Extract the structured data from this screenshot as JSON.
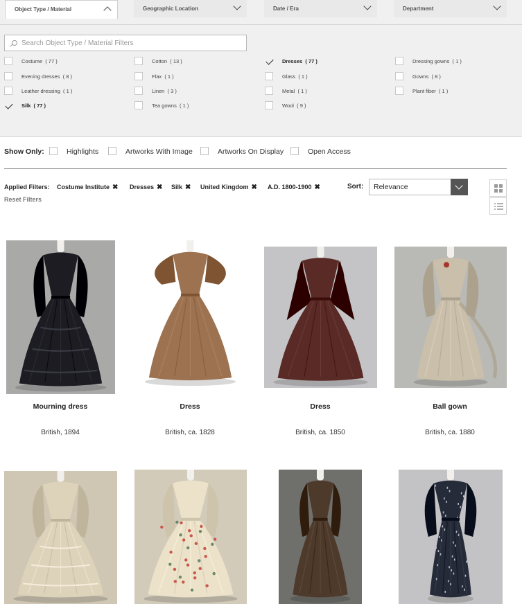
{
  "filters": {
    "dropdowns": [
      {
        "label": "Object Type / Material",
        "open": true
      },
      {
        "label": "Geographic Location",
        "open": false
      },
      {
        "label": "Date / Era",
        "open": false
      },
      {
        "label": "Department",
        "open": false
      }
    ],
    "search_placeholder": "Search Object Type / Material Filters",
    "options": [
      {
        "label": "Costume",
        "count": "( 77 )",
        "checked": false
      },
      {
        "label": "Evening dresses",
        "count": "( 8 )",
        "checked": false
      },
      {
        "label": "Leather dressing",
        "count": "( 1 )",
        "checked": false
      },
      {
        "label": "Silk",
        "count": "( 77 )",
        "checked": true
      },
      {
        "label": "Cotton",
        "count": "( 13 )",
        "checked": false
      },
      {
        "label": "Flax",
        "count": "( 1 )",
        "checked": false
      },
      {
        "label": "Linen",
        "count": "( 3 )",
        "checked": false
      },
      {
        "label": "Tea gowns",
        "count": "( 1 )",
        "checked": false
      },
      {
        "label": "Dresses",
        "count": "( 77 )",
        "checked": true
      },
      {
        "label": "Glass",
        "count": "( 1 )",
        "checked": false
      },
      {
        "label": "Metal",
        "count": "( 1 )",
        "checked": false
      },
      {
        "label": "Wool",
        "count": "( 9 )",
        "checked": false
      },
      {
        "label": "Dressing gowns",
        "count": "( 1 )",
        "checked": false
      },
      {
        "label": "Gowns",
        "count": "( 8 )",
        "checked": false
      },
      {
        "label": "Plant fiber",
        "count": "( 1 )",
        "checked": false
      }
    ]
  },
  "show_only": {
    "label": "Show Only:",
    "options": [
      "Highlights",
      "Artworks With Image",
      "Artworks On Display",
      "Open Access"
    ]
  },
  "applied": {
    "label": "Applied Filters:",
    "chips": [
      "Costume Institute",
      "Dresses",
      "Silk",
      "United Kingdom",
      "A.D. 1800-1900"
    ],
    "remove_icon": "✖",
    "reset_label": "Reset Filters"
  },
  "sort": {
    "label": "Sort:",
    "value": "Relevance"
  },
  "view_icons": [
    "grid-view-icon",
    "list-view-icon"
  ],
  "results": [
    {
      "title": "Mourning dress",
      "meta": "British, 1894",
      "fabric": "#1c1c22",
      "bg": "#a9a9a8",
      "style": "mourning"
    },
    {
      "title": "Dress",
      "meta": "British, ca. 1828",
      "fabric": "#9c7250",
      "bg": "#ffffff",
      "style": "puff"
    },
    {
      "title": "Dress",
      "meta": "British, ca. 1850",
      "fabric": "#5a2a26",
      "bg": "#c4c4c6",
      "style": "cape"
    },
    {
      "title": "Ball gown",
      "meta": "British, ca. 1880",
      "fabric": "#c9bfaa",
      "bg": "#b9b9b6",
      "style": "bustle"
    },
    {
      "fabric": "#ddd2ba",
      "bg": "#cfc6b3",
      "style": "tiered"
    },
    {
      "fabric": "#ece1c9",
      "bg": "#d2cbba",
      "style": "floral"
    },
    {
      "fabric": "#4e3a2a",
      "bg": "#6f6f6c",
      "style": "brown"
    },
    {
      "fabric": "#262b3a",
      "bg": "#c3c3c5",
      "style": "column"
    }
  ]
}
